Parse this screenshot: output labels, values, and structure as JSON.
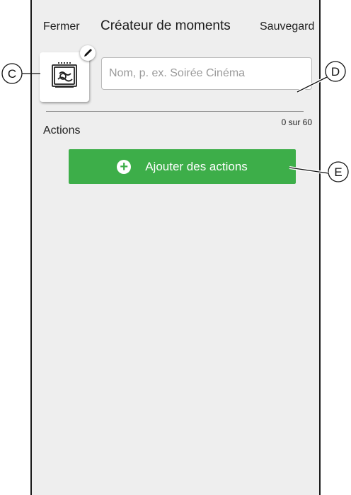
{
  "header": {
    "close_label": "Fermer",
    "title": "Créateur de moments",
    "save_label": "Sauvegard"
  },
  "moment": {
    "icon_name": "tv-icon",
    "edit_icon_name": "pencil-icon",
    "name_placeholder": "Nom, p. ex. Soirée Cinéma",
    "name_value": ""
  },
  "actions": {
    "label": "Actions",
    "counter": "0 sur 60",
    "add_label": "Ajouter des actions",
    "add_icon_name": "plus-circle-icon"
  },
  "callouts": {
    "c": "C",
    "d": "D",
    "e": "E"
  },
  "colors": {
    "accent": "#3dae49",
    "background": "#eeeeee"
  }
}
